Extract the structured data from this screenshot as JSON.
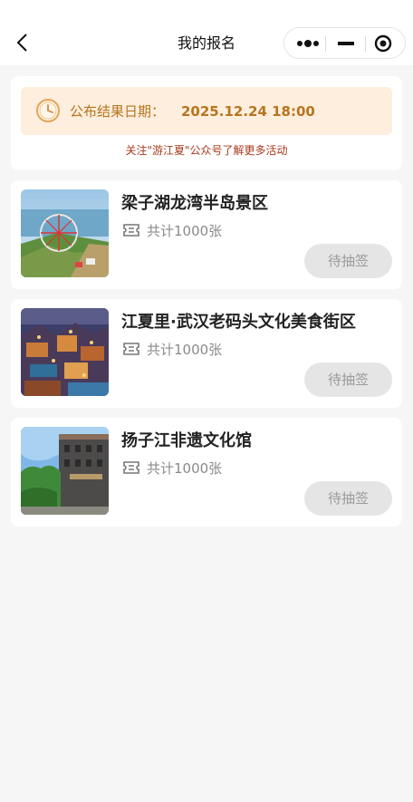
{
  "header": {
    "title": "我的报名"
  },
  "notice": {
    "date_label": "公布结果日期：",
    "date_value": "2025.12.24 18:00",
    "tip": "关注\"游江夏\"公众号了解更多活动"
  },
  "cards": [
    {
      "title": "梁子湖龙湾半岛景区",
      "count": "共计1000张",
      "status": "待抽签"
    },
    {
      "title": "江夏里·武汉老码头文化美食街区",
      "count": "共计1000张",
      "status": "待抽签"
    },
    {
      "title": "扬子江非遗文化馆",
      "count": "共计1000张",
      "status": "待抽签"
    }
  ],
  "colors": {
    "accent": "#b8741f",
    "notice_bg": "#fdeedd",
    "tip": "#a83a1c",
    "button_bg": "#e5e5e5",
    "button_text": "#9b9b9b"
  },
  "icons": {
    "back": "chevron-left-icon",
    "more": "more-dots-icon",
    "minimize": "minimize-icon",
    "close": "capsule-close-icon",
    "clock": "clock-icon",
    "ticket": "ticket-icon"
  }
}
